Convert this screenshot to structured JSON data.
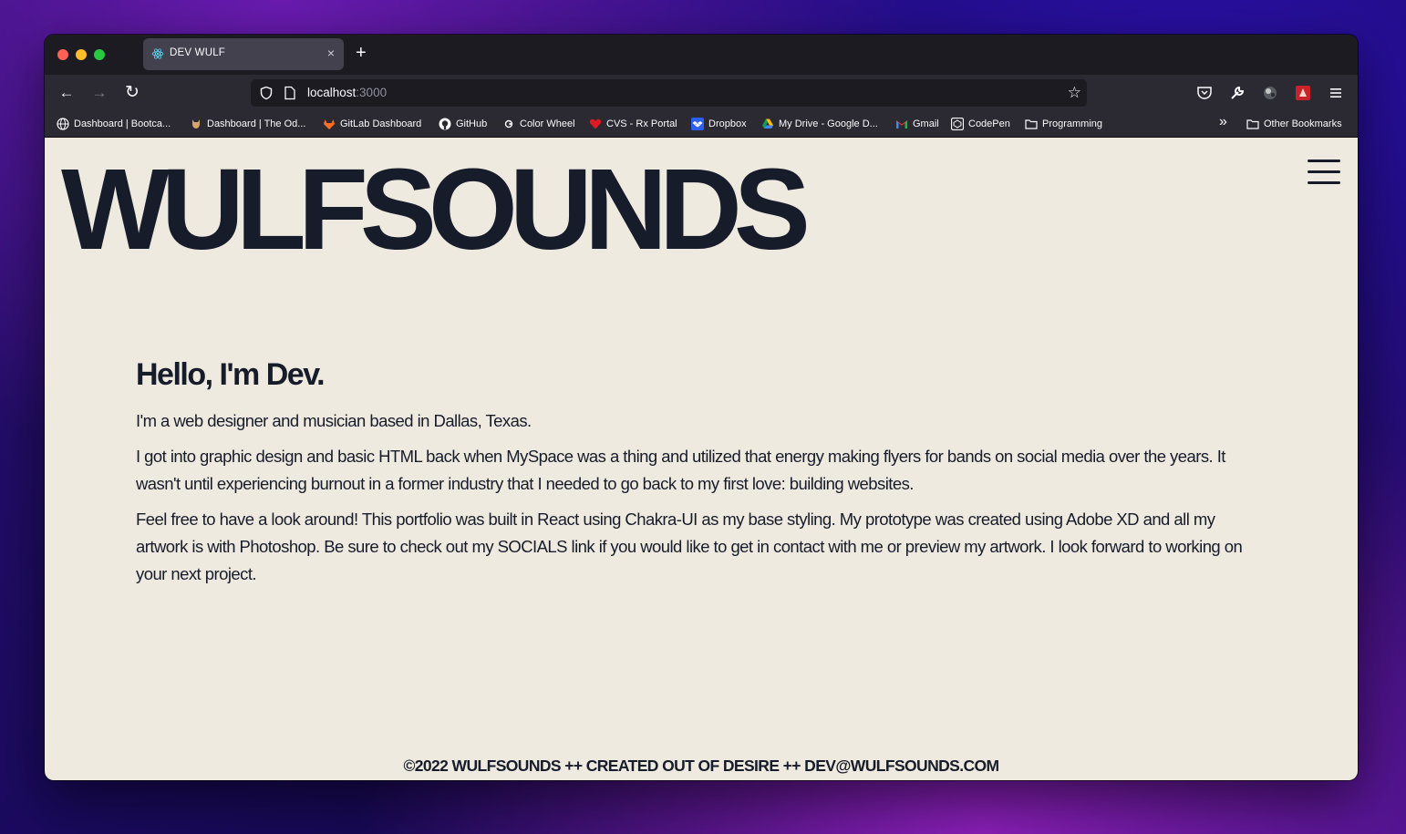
{
  "browser": {
    "tab": {
      "title": "DEV WULF",
      "close": "×"
    },
    "new_tab": "+",
    "nav": {
      "back": "←",
      "forward": "→",
      "reload": "↻"
    },
    "url": {
      "host": "localhost",
      "port": ":3000"
    },
    "star": "☆",
    "toolbar_icons": [
      "pocket-icon",
      "wrench-icon",
      "extension-icon",
      "avatar-icon",
      "menu-icon"
    ]
  },
  "bookmarks": [
    {
      "label": "Dashboard | Bootca...",
      "icon": "globe-icon"
    },
    {
      "label": "Dashboard | The Od...",
      "icon": "odin-icon"
    },
    {
      "label": "GitLab Dashboard",
      "icon": "gitlab-icon"
    },
    {
      "label": "GitHub",
      "icon": "github-icon"
    },
    {
      "label": "Color Wheel",
      "icon": "color-wheel-icon"
    },
    {
      "label": "CVS - Rx Portal",
      "icon": "heart-icon"
    },
    {
      "label": "Dropbox",
      "icon": "dropbox-icon"
    },
    {
      "label": "My Drive - Google D...",
      "icon": "drive-icon"
    },
    {
      "label": "Gmail",
      "icon": "gmail-icon"
    },
    {
      "label": "CodePen",
      "icon": "codepen-icon"
    },
    {
      "label": "Programming",
      "icon": "folder-icon"
    }
  ],
  "bookmarks_overflow": "»",
  "other_bookmarks": "Other Bookmarks",
  "page": {
    "logo": "WULFSOUNDS",
    "greeting": "Hello, I'm Dev.",
    "paragraphs": [
      "I'm a web designer and musician based in Dallas, Texas.",
      "I got into graphic design and basic HTML back when MySpace was a thing and utilized that energy making flyers for bands on social media over the years. It wasn't until experiencing burnout in a former industry that I needed to go back to my first love: building websites.",
      "Feel free to have a look around! This portfolio was built in React using Chakra-UI as my base styling. My prototype was created using Adobe XD and all my artwork is with Photoshop. Be sure to check out my SOCIALS link if you would like to get in contact with me or preview my artwork. I look forward to working on your next project."
    ],
    "footer": "©2022 WULFSOUNDS ++ CREATED OUT OF DESIRE ++ DEV@WULFSOUNDS.COM"
  },
  "colors": {
    "page_bg": "#efeae0",
    "text": "#171c2b",
    "chrome_dark": "#1c1b22",
    "chrome": "#2b2a33"
  }
}
